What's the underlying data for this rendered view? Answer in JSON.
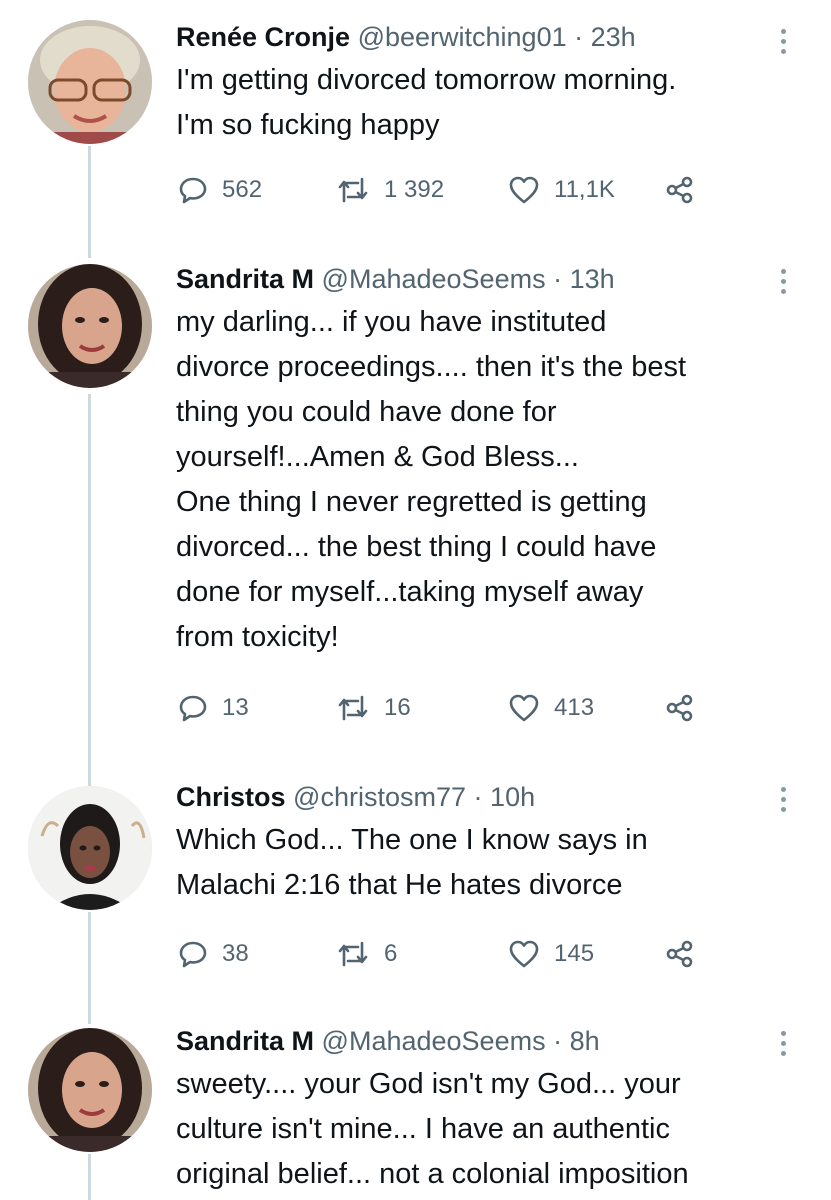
{
  "tweets": [
    {
      "name": "Renée Cronje",
      "handle": "@beerwitching01",
      "time": "23h",
      "text": "I'm getting divorced tomorrow morning.\nI'm so fucking happy",
      "replies": "562",
      "retweets": "1 392",
      "likes": "11,1K"
    },
    {
      "name": "Sandrita M",
      "handle": "@MahadeoSeems",
      "time": "13h",
      "text": "my darling... if you have instituted\ndivorce proceedings.... then it's the best\nthing you could have done for\nyourself!...Amen & God Bless...\nOne thing I never regretted is getting\ndivorced... the best thing I could have\ndone for myself...taking myself away\nfrom toxicity!",
      "replies": "13",
      "retweets": "16",
      "likes": "413"
    },
    {
      "name": "Christos",
      "handle": "@christosm77",
      "time": "10h",
      "text": "Which God... The one I know says in\nMalachi 2:16 that He hates divorce",
      "replies": "38",
      "retweets": "6",
      "likes": "145"
    },
    {
      "name": "Sandrita M",
      "handle": "@MahadeoSeems",
      "time": "8h",
      "text": "sweety.... your God isn't my God... your\nculture isn't mine... I have an authentic\noriginal belief... not a colonial imposition"
    }
  ],
  "separator": "·",
  "icons": {
    "reply": "reply-icon",
    "retweet": "retweet-icon",
    "like": "heart-icon",
    "share": "share-icon",
    "more": "more-icon"
  },
  "colors": {
    "text": "#0f1419",
    "muted": "#536471",
    "thread_line": "#cfd9de"
  }
}
